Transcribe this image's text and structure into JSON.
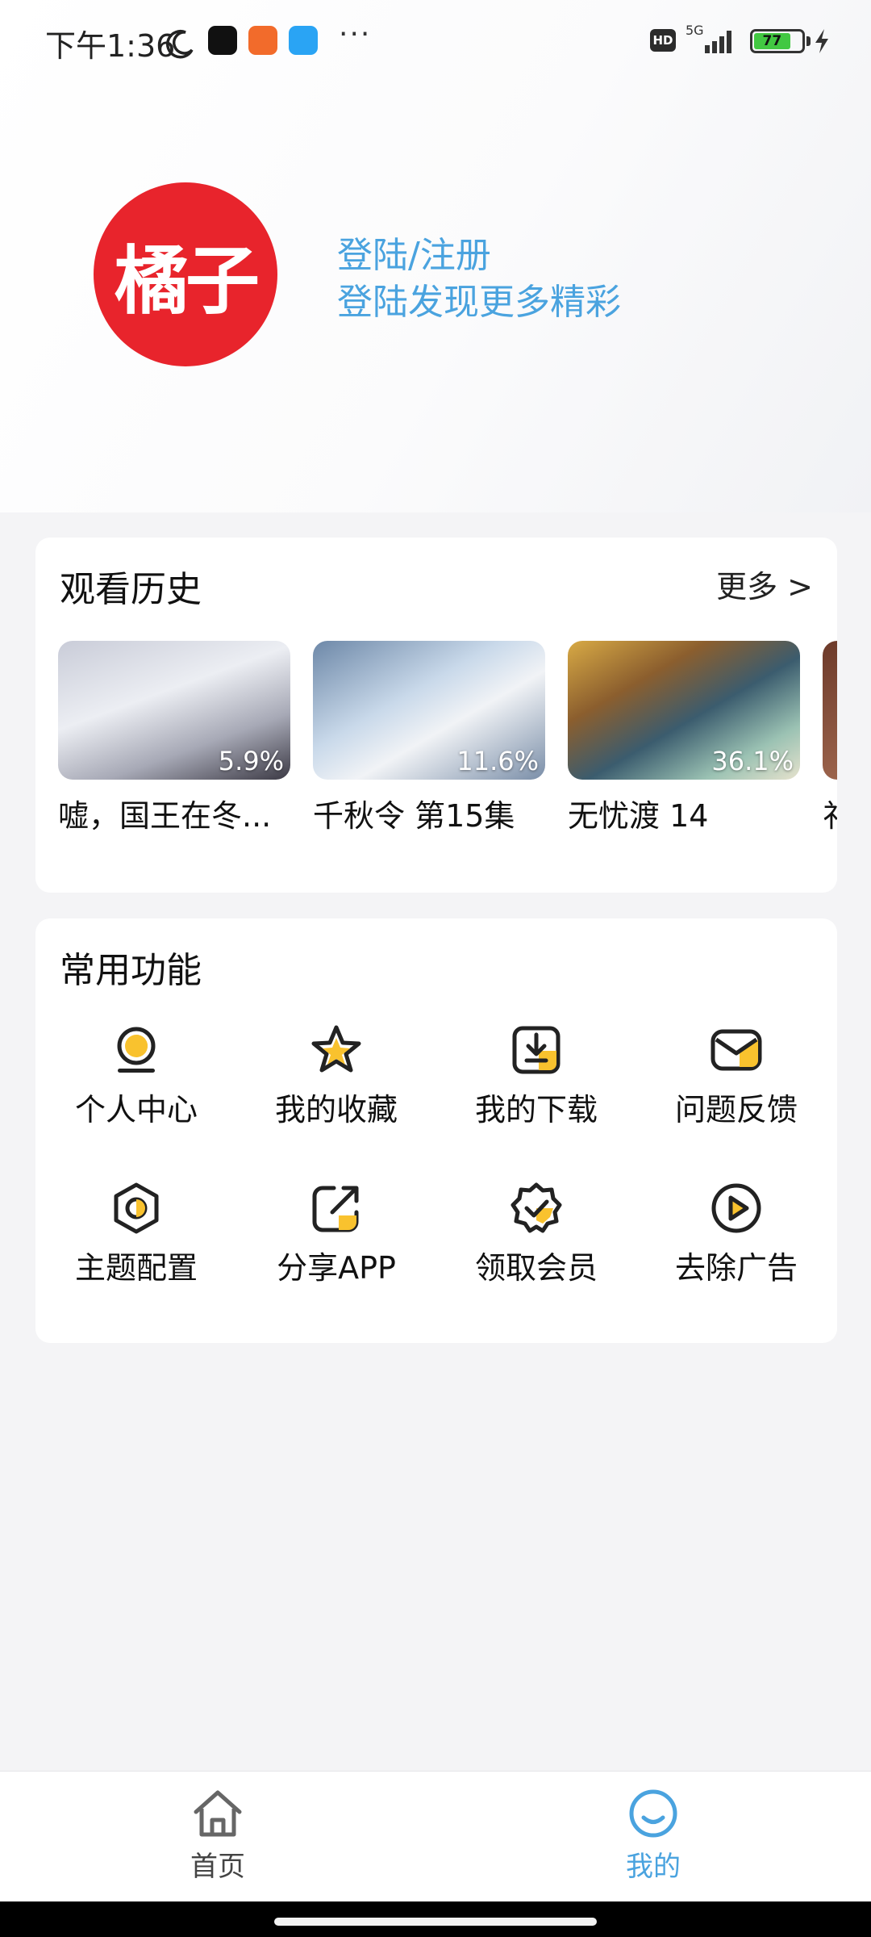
{
  "status_bar": {
    "time": "下午1:36",
    "network": "5G",
    "hd": "HD",
    "battery": "77",
    "dots": "···"
  },
  "profile": {
    "logo_text": "橘子",
    "login_title": "登陆/注册",
    "login_subtitle": "登陆发现更多精彩"
  },
  "history": {
    "title": "观看历史",
    "more": "更多 >",
    "items": [
      {
        "title": "嘘，国王在冬...",
        "progress": "5.9%"
      },
      {
        "title": "千秋令 第15集",
        "progress": "11.6%"
      },
      {
        "title": "无忧渡 14",
        "progress": "36.1%"
      },
      {
        "title": "祁"
      }
    ]
  },
  "functions": {
    "title": "常用功能",
    "items": [
      {
        "label": "个人中心",
        "icon": "person-icon"
      },
      {
        "label": "我的收藏",
        "icon": "star-icon"
      },
      {
        "label": "我的下载",
        "icon": "download-icon"
      },
      {
        "label": "问题反馈",
        "icon": "mail-icon"
      },
      {
        "label": "主题配置",
        "icon": "theme-icon"
      },
      {
        "label": "分享APP",
        "icon": "share-icon"
      },
      {
        "label": "领取会员",
        "icon": "vip-badge-icon"
      },
      {
        "label": "去除广告",
        "icon": "play-circle-icon"
      }
    ]
  },
  "bottom_nav": {
    "home": "首页",
    "mine": "我的"
  },
  "colors": {
    "accent": "#4aa3df",
    "logo_red": "#e8242c",
    "icon_yellow": "#f9c22e"
  }
}
